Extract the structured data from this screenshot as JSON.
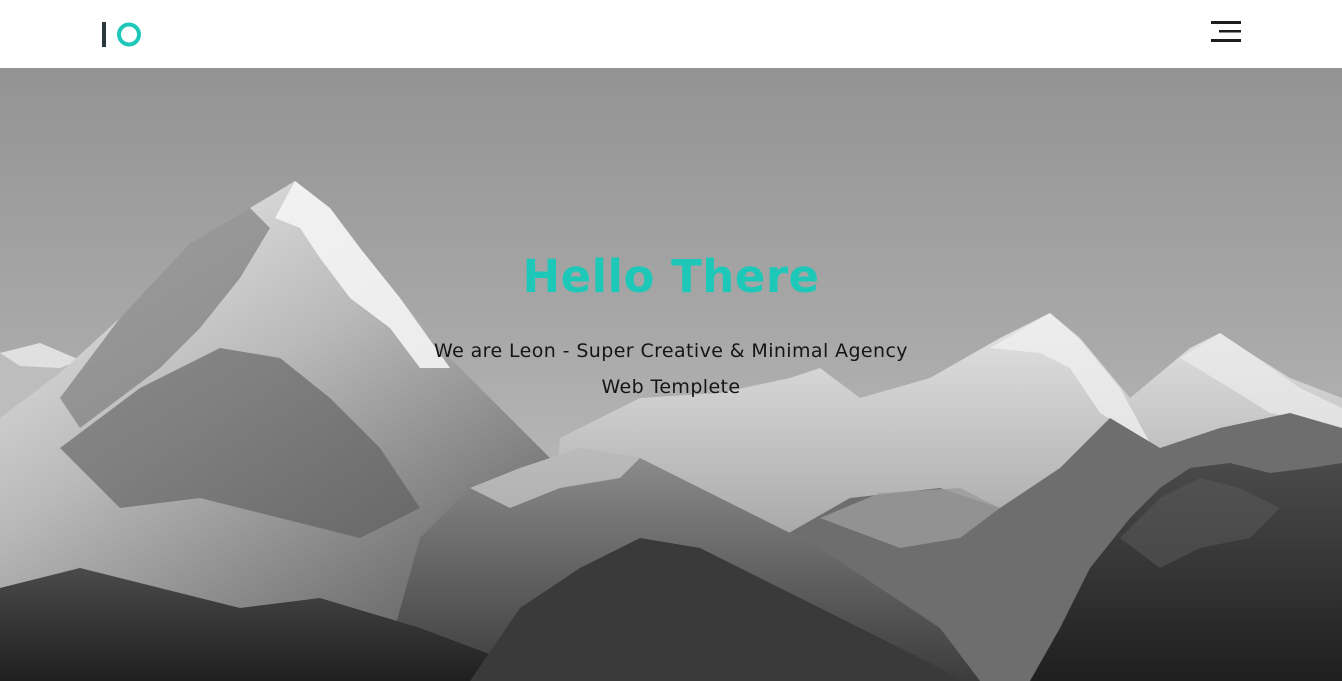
{
  "colors": {
    "accent": "#1ec8b8",
    "logo_dark": "#2a3a3c",
    "menu_icon": "#1e1e1e",
    "sky_top": "#939393",
    "sky_bottom": "#bcbcbc"
  },
  "header": {
    "logo_icon": "io-logo-icon",
    "menu_icon": "hamburger-menu-icon"
  },
  "hero": {
    "background_icon": "snowy-mountain-range-image",
    "title": "Hello There",
    "subtitle": "We are Leon - Super Creative & Minimal Agency Web Templete"
  }
}
